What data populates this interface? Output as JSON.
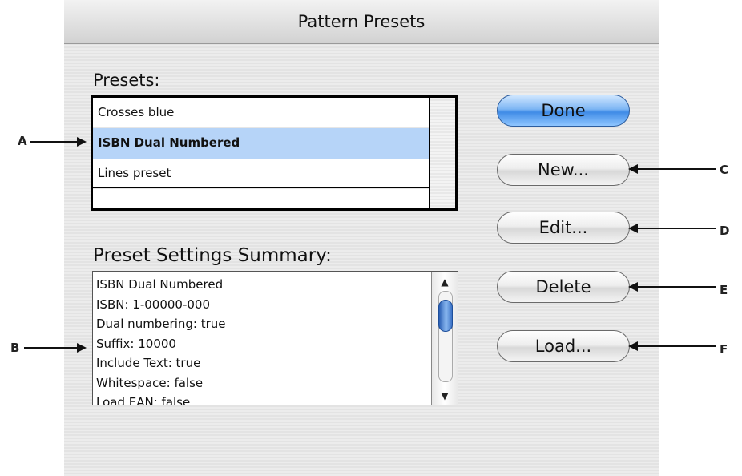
{
  "dialog": {
    "title": "Pattern Presets",
    "presets_label": "Presets:",
    "presets": [
      {
        "label": "Crosses blue",
        "selected": false
      },
      {
        "label": "ISBN Dual Numbered",
        "selected": true
      },
      {
        "label": "Lines preset",
        "selected": false
      }
    ],
    "summary_label": "Preset Settings Summary:",
    "summary_lines": [
      "ISBN Dual Numbered",
      "ISBN: 1-00000-000",
      "Dual numbering: true",
      "Suffix: 10000",
      "Include Text: true",
      "Whitespace: false",
      "Load EAN: false"
    ]
  },
  "buttons": {
    "done": "Done",
    "new": "New...",
    "edit": "Edit...",
    "delete": "Delete",
    "load": "Load..."
  },
  "callouts": {
    "a": "A",
    "b": "B",
    "c": "C",
    "d": "D",
    "e": "E",
    "f": "F"
  },
  "colors": {
    "selection": "#b6d4f8",
    "primary_button": "#3f8be6",
    "scroll_thumb": "#2a5fb4"
  },
  "icons": {
    "scroll_up": "up-arrow-icon",
    "scroll_down": "down-arrow-icon",
    "callout_arrow": "arrow-icon"
  }
}
